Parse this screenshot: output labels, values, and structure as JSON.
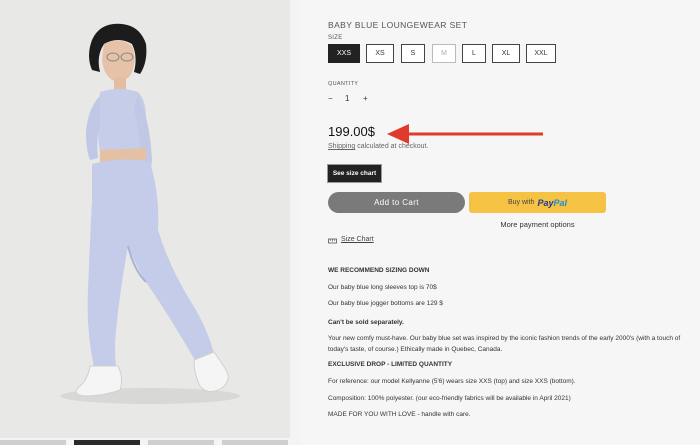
{
  "product": {
    "title": "BABY BLUE LOUNGEWEAR SET",
    "size_label": "SIZE",
    "sizes": [
      {
        "label": "XXS",
        "state": "selected"
      },
      {
        "label": "XS",
        "state": "available"
      },
      {
        "label": "S",
        "state": "available"
      },
      {
        "label": "M",
        "state": "disabled"
      },
      {
        "label": "L",
        "state": "available"
      },
      {
        "label": "XL",
        "state": "available"
      },
      {
        "label": "XXL",
        "state": "available"
      }
    ],
    "quantity_label": "QUANTITY",
    "quantity": {
      "minus": "−",
      "value": "1",
      "plus": "+"
    },
    "price": "199.00$",
    "shipping_link": "Shipping",
    "shipping_text": " calculated at checkout.",
    "size_chart_button": "See size chart",
    "add_to_cart": "Add to Cart",
    "paypal_prefix": "Buy with",
    "paypal_logo_pay": "Pay",
    "paypal_logo_pal": "Pal",
    "more_payment": "More payment options",
    "size_chart_link": "Size Chart"
  },
  "description": {
    "heading1": "WE RECOMMEND SIZING DOWN",
    "line1": "Our baby blue long sleeves top is 70$",
    "line2": "Our baby blue jogger bottoms are 129 $",
    "notice": "Can't be sold separately.",
    "paragraph": "Your new comfy must-have. Our baby blue set was inspired by the iconic fashion trends of the early 2000's (with a touch of today's taste, of course.) Ethically made in Quebec, Canada.",
    "heading2": "EXCLUSIVE DROP - LIMITED QUANTITY",
    "reference": " For reference: our model Kellyanne (5'6) wears size XXS (top) and size XXS (bottom).",
    "composition": "Composition: 100% polyester. (our eco-friendly fabrics will be available in April 2021)",
    "made": "MADE FOR YOU WITH LOVE - handle with care."
  },
  "colors": {
    "selected_size": "#222222",
    "cart_button": "#7a7a7a",
    "paypal_button": "#f6c244",
    "annotation_arrow": "#e03a2c"
  },
  "icons": {
    "size_chart": "ruler-icon",
    "annotation": "red-arrow-left"
  }
}
